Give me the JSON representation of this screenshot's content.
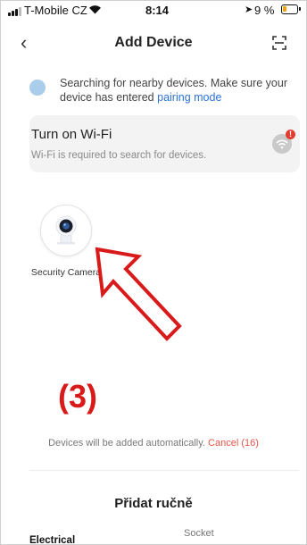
{
  "status_bar": {
    "carrier": "T-Mobile CZ",
    "time": "8:14",
    "battery_percent": "9 %",
    "battery_color": "#f0a000",
    "icons": [
      "signal-icon",
      "wifi-icon",
      "location-icon",
      "battery-icon"
    ]
  },
  "nav": {
    "back_icon": "chevron-left-icon",
    "title": "Add Device",
    "scan_icon": "scan-icon"
  },
  "searching": {
    "text": "Searching for nearby devices. Make sure your device has entered",
    "link": "pairing mode"
  },
  "wifi_card": {
    "title": "Turn on Wi-Fi",
    "subtitle": "Wi-Fi is required to search for devices.",
    "alert_mark": "!",
    "alert_color": "#e23c2f"
  },
  "device": {
    "name": "Security Camera",
    "icon": "security-camera-icon"
  },
  "annotation": {
    "step": "(3)",
    "color": "#d81a1a"
  },
  "footer": {
    "auto_text": "Devices will be added automatically.",
    "cancel_label": "Cancel (16)",
    "cancel_color": "#e45346",
    "manual_title": "Přidat ručně",
    "categories": [
      "Electrical",
      "Socket"
    ]
  },
  "colors": {
    "link": "#2b73d9"
  }
}
